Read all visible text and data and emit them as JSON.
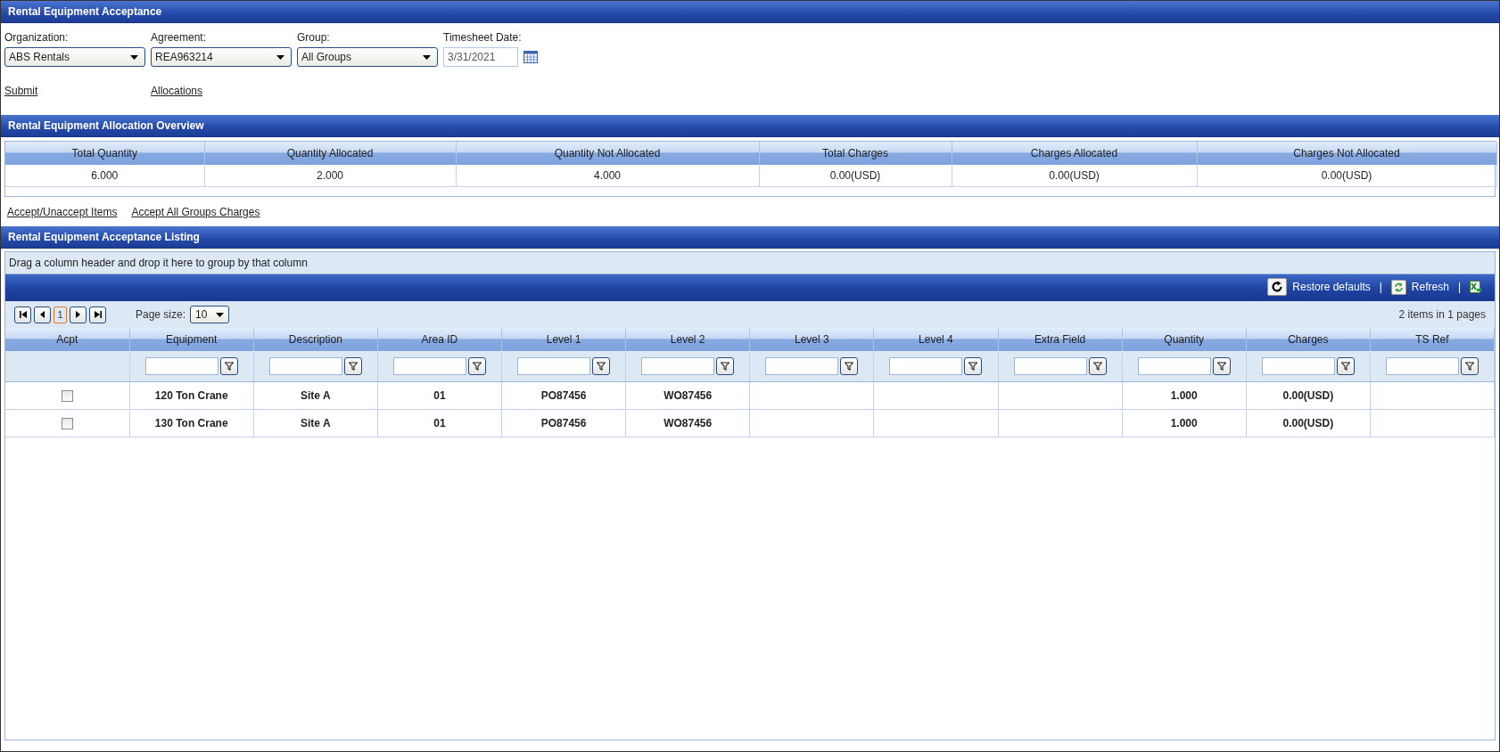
{
  "window": {
    "title": "Rental Equipment Acceptance"
  },
  "filters": [
    {
      "label": "Organization:",
      "value": "ABS Rentals",
      "kind": "select"
    },
    {
      "label": "Agreement:",
      "value": "REA963214",
      "kind": "select"
    },
    {
      "label": "Group:",
      "value": "All Groups",
      "kind": "select"
    },
    {
      "label": "Timesheet Date:",
      "value": "3/31/2021",
      "kind": "date"
    }
  ],
  "actions": [
    "Submit",
    "Allocations"
  ],
  "overview": {
    "title": "Rental Equipment Allocation Overview",
    "columns": [
      "Total Quantity",
      "Quantity Allocated",
      "Quantity Not Allocated",
      "Total Charges",
      "Charges Allocated",
      "Charges Not Allocated"
    ],
    "values": [
      "6.000",
      "2.000",
      "4.000",
      "0.00(USD)",
      "0.00(USD)",
      "0.00(USD)"
    ]
  },
  "listing_links": [
    "Accept/Unaccept Items",
    "Accept All Groups Charges"
  ],
  "listing": {
    "title": "Rental Equipment Acceptance Listing",
    "group_hint": "Drag a column header and drop it here to group by that column",
    "toolbar": [
      {
        "kind": "restore",
        "label": "Restore defaults"
      },
      {
        "kind": "separator",
        "label": "|"
      },
      {
        "kind": "refresh",
        "label": "Refresh"
      },
      {
        "kind": "separator",
        "label": "|"
      },
      {
        "kind": "export"
      }
    ],
    "pager": {
      "pages": [
        {
          "label": "1",
          "selected": true
        }
      ],
      "page_size_label": "Page size:",
      "page_size": "10",
      "summary": "2 items in 1 pages"
    },
    "columns": [
      {
        "label": "Acpt",
        "filterable": false
      },
      {
        "label": "Equipment",
        "filterable": true
      },
      {
        "label": "Description",
        "filterable": true
      },
      {
        "label": "Area ID",
        "filterable": true
      },
      {
        "label": "Level 1",
        "filterable": true
      },
      {
        "label": "Level 2",
        "filterable": true
      },
      {
        "label": "Level 3",
        "filterable": true
      },
      {
        "label": "Level 4",
        "filterable": true
      },
      {
        "label": "Extra Field",
        "filterable": true
      },
      {
        "label": "Quantity",
        "filterable": true
      },
      {
        "label": "Charges",
        "filterable": true
      },
      {
        "label": "TS Ref",
        "filterable": true
      }
    ],
    "rows": [
      {
        "checked": false,
        "cells": [
          null,
          "120 Ton Crane",
          "Site A",
          "01",
          "PO87456",
          "WO87456",
          null,
          null,
          null,
          "1.000",
          "0.00(USD)",
          null
        ]
      },
      {
        "checked": false,
        "cells": [
          null,
          "130 Ton Crane",
          "Site A",
          "01",
          "PO87456",
          "WO87456",
          null,
          null,
          null,
          "1.000",
          "0.00(USD)",
          null
        ]
      }
    ]
  }
}
